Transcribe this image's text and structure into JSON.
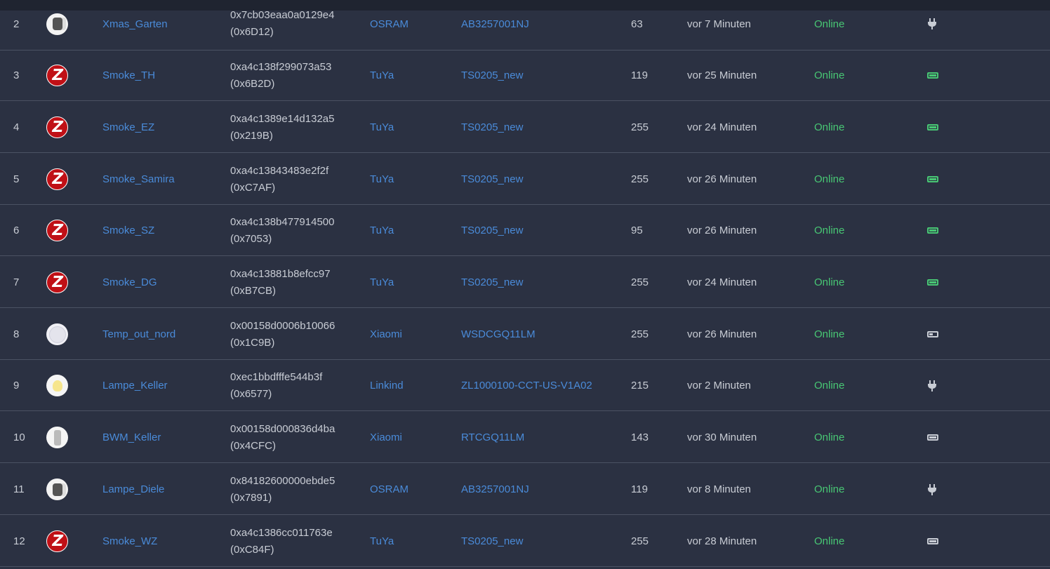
{
  "devices": [
    {
      "num": "2",
      "icon": "plug-image",
      "name": "Xmas_Garten",
      "ieee": "0x7cb03eaa0a0129e4",
      "nwk": "(0x6D12)",
      "vendor": "OSRAM",
      "model": "AB3257001NJ",
      "lqi": "63",
      "last_seen": "vor 7 Minuten",
      "status": "Online",
      "power": "plug-icon"
    },
    {
      "num": "3",
      "icon": "zigbee-logo",
      "name": "Smoke_TH",
      "ieee": "0xa4c138f299073a53",
      "nwk": "(0x6B2D)",
      "vendor": "TuYa",
      "model": "TS0205_new",
      "lqi": "119",
      "last_seen": "vor 25 Minuten",
      "status": "Online",
      "power": "battery-full-icon"
    },
    {
      "num": "4",
      "icon": "zigbee-logo",
      "name": "Smoke_EZ",
      "ieee": "0xa4c1389e14d132a5",
      "nwk": "(0x219B)",
      "vendor": "TuYa",
      "model": "TS0205_new",
      "lqi": "255",
      "last_seen": "vor 24 Minuten",
      "status": "Online",
      "power": "battery-full-icon"
    },
    {
      "num": "5",
      "icon": "zigbee-logo",
      "name": "Smoke_Samira",
      "ieee": "0xa4c13843483e2f2f",
      "nwk": "(0xC7AF)",
      "vendor": "TuYa",
      "model": "TS0205_new",
      "lqi": "255",
      "last_seen": "vor 26 Minuten",
      "status": "Online",
      "power": "battery-full-icon"
    },
    {
      "num": "6",
      "icon": "zigbee-logo",
      "name": "Smoke_SZ",
      "ieee": "0xa4c138b477914500",
      "nwk": "(0x7053)",
      "vendor": "TuYa",
      "model": "TS0205_new",
      "lqi": "95",
      "last_seen": "vor 26 Minuten",
      "status": "Online",
      "power": "battery-full-icon"
    },
    {
      "num": "7",
      "icon": "zigbee-logo",
      "name": "Smoke_DG",
      "ieee": "0xa4c13881b8efcc97",
      "nwk": "(0xB7CB)",
      "vendor": "TuYa",
      "model": "TS0205_new",
      "lqi": "255",
      "last_seen": "vor 24 Minuten",
      "status": "Online",
      "power": "battery-full-icon"
    },
    {
      "num": "8",
      "icon": "sensor-image",
      "name": "Temp_out_nord",
      "ieee": "0x00158d0006b10066",
      "nwk": "(0x1C9B)",
      "vendor": "Xiaomi",
      "model": "WSDCGQ11LM",
      "lqi": "255",
      "last_seen": "vor 26 Minuten",
      "status": "Online",
      "power": "battery-low-icon"
    },
    {
      "num": "9",
      "icon": "bulb-image",
      "name": "Lampe_Keller",
      "ieee": "0xec1bbdfffe544b3f",
      "nwk": "(0x6577)",
      "vendor": "Linkind",
      "model": "ZL1000100-CCT-US-V1A02",
      "lqi": "215",
      "last_seen": "vor 2 Minuten",
      "status": "Online",
      "power": "plug-icon"
    },
    {
      "num": "10",
      "icon": "motion-image",
      "name": "BWM_Keller",
      "ieee": "0x00158d000836d4ba",
      "nwk": "(0x4CFC)",
      "vendor": "Xiaomi",
      "model": "RTCGQ11LM",
      "lqi": "143",
      "last_seen": "vor 30 Minuten",
      "status": "Online",
      "power": "battery-grey-full-icon"
    },
    {
      "num": "11",
      "icon": "plug-image",
      "name": "Lampe_Diele",
      "ieee": "0x84182600000ebde5",
      "nwk": "(0x7891)",
      "vendor": "OSRAM",
      "model": "AB3257001NJ",
      "lqi": "119",
      "last_seen": "vor 8 Minuten",
      "status": "Online",
      "power": "plug-icon"
    },
    {
      "num": "12",
      "icon": "zigbee-logo",
      "name": "Smoke_WZ",
      "ieee": "0xa4c1386cc011763e",
      "nwk": "(0xC84F)",
      "vendor": "TuYa",
      "model": "TS0205_new",
      "lqi": "255",
      "last_seen": "vor 28 Minuten",
      "status": "Online",
      "power": "battery-grey-full-icon"
    }
  ],
  "colors": {
    "background": "#2b3142",
    "link": "#4a8bd9",
    "online": "#48c774",
    "text": "#c8ccd4",
    "divider": "#4b5263"
  }
}
